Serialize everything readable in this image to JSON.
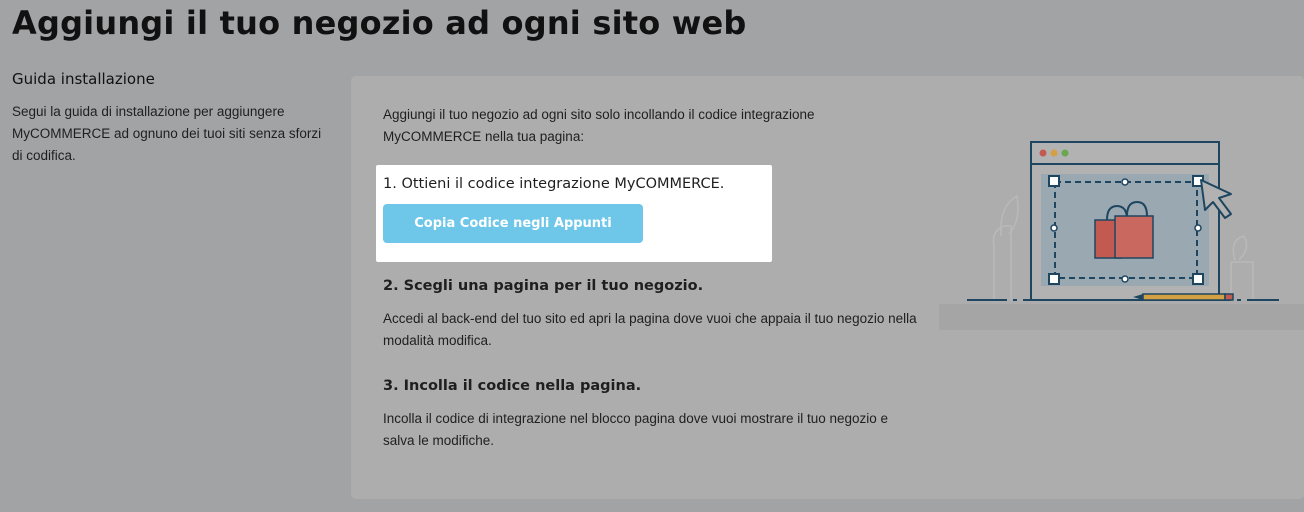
{
  "page": {
    "title": "Aggiungi il tuo negozio ad ogni sito web"
  },
  "sidebar": {
    "heading": "Guida installazione",
    "description": "Segui la guida di installazione per aggiungere MyCOMMERCE ad ognuno dei tuoi siti senza sforzi di codifica."
  },
  "card": {
    "intro": "Aggiungi il tuo negozio ad ogni sito solo incollando il codice integrazione MyCOMMERCE nella tua pagina:",
    "steps": [
      {
        "title": "1. Ottieni il codice integrazione MyCOMMERCE.",
        "button_label": "Copia Codice negli Appunti"
      },
      {
        "title": "2. Scegli una pagina per il tuo negozio.",
        "text": "Accedi al back-end del tuo sito ed apri la pagina dove vuoi che appaia il tuo negozio nella modalità modifica."
      },
      {
        "title": "3. Incolla il codice nella pagina.",
        "text": "Incolla il codice di integrazione nel blocco pagina dove vuoi mostrare il tuo negozio e salva le modifiche."
      }
    ]
  },
  "colors": {
    "overlay_background": "#a2a3a5",
    "card_background": "#adadad",
    "spotlight": "#ffffff",
    "button": "#6ec7e8",
    "illustration_line": "#1e4660",
    "bag": "#c25a52"
  },
  "icons": [
    "browser-window-icon",
    "shopping-bag-icon",
    "mouse-cursor-icon",
    "pencil-icon",
    "plant-icon"
  ]
}
